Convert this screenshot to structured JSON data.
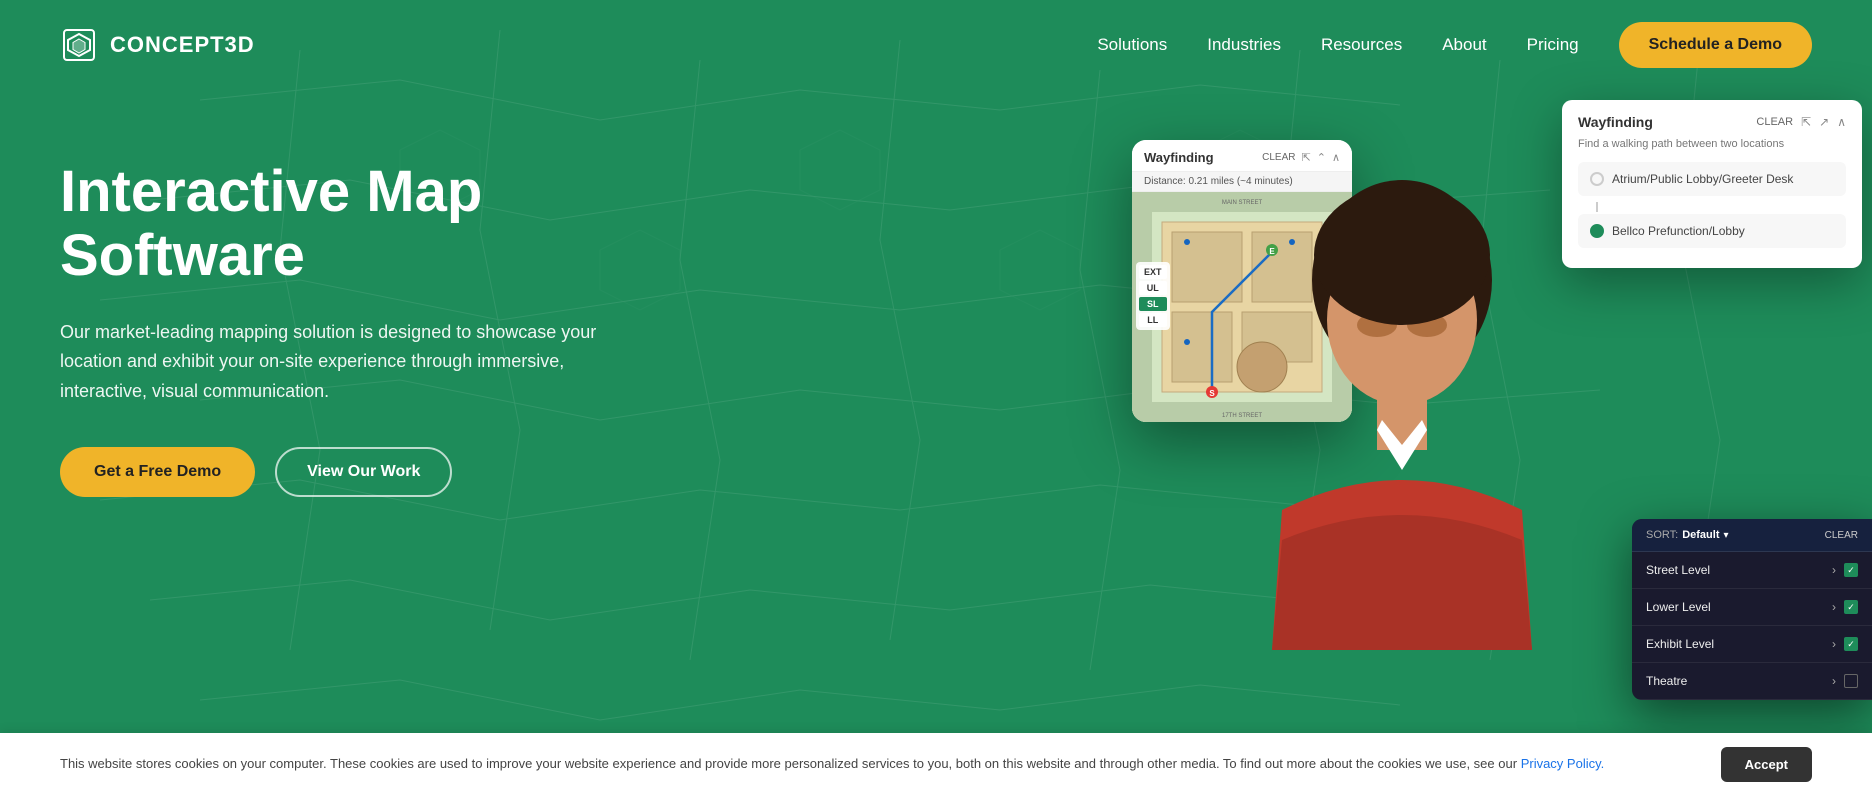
{
  "header": {
    "logo_text": "CONCEPT3D",
    "nav": [
      {
        "label": "Solutions",
        "id": "solutions"
      },
      {
        "label": "Industries",
        "id": "industries"
      },
      {
        "label": "Resources",
        "id": "resources"
      },
      {
        "label": "About",
        "id": "about"
      },
      {
        "label": "Pricing",
        "id": "pricing"
      }
    ],
    "cta_label": "Schedule a Demo"
  },
  "hero": {
    "title": "Interactive Map Software",
    "subtitle": "Our market-leading mapping solution is designed to showcase your location and exhibit your on-site experience through immersive, interactive, visual communication.",
    "btn_primary": "Get a Free Demo",
    "btn_secondary": "View Our Work"
  },
  "map_panel": {
    "title": "Wayfinding",
    "clear": "CLEAR",
    "distance": "Distance: 0.21 miles (~4 minutes)",
    "floors": [
      "EXT",
      "UL",
      "SL",
      "LL"
    ],
    "active_floor": "SL"
  },
  "wayfinding_panel": {
    "title": "Wayfinding",
    "clear": "CLEAR",
    "subtitle": "Find a walking path between two locations",
    "from_label": "Atrium/Public Lobby/Greeter Desk",
    "to_label": "Bellco Prefunction/Lobby"
  },
  "floor_list_panel": {
    "sort_label": "SORT:",
    "sort_value": "Default",
    "clear": "CLEAR",
    "items": [
      {
        "name": "Street Level",
        "checked": true
      },
      {
        "name": "Lower Level",
        "checked": true
      },
      {
        "name": "Exhibit Level",
        "checked": true
      },
      {
        "name": "Theatre",
        "checked": false
      }
    ]
  },
  "cookie_bar": {
    "text": "This website stores cookies on your computer. These cookies are used to improve your website experience and provide more personalized services to you, both on this website and through other media. To find out more about the cookies we use, see our",
    "link_text": "Privacy Policy.",
    "accept_label": "Accept"
  },
  "colors": {
    "brand_green": "#1e8c5a",
    "brand_yellow": "#f0b429",
    "dark_bg": "#1a1a2e"
  }
}
